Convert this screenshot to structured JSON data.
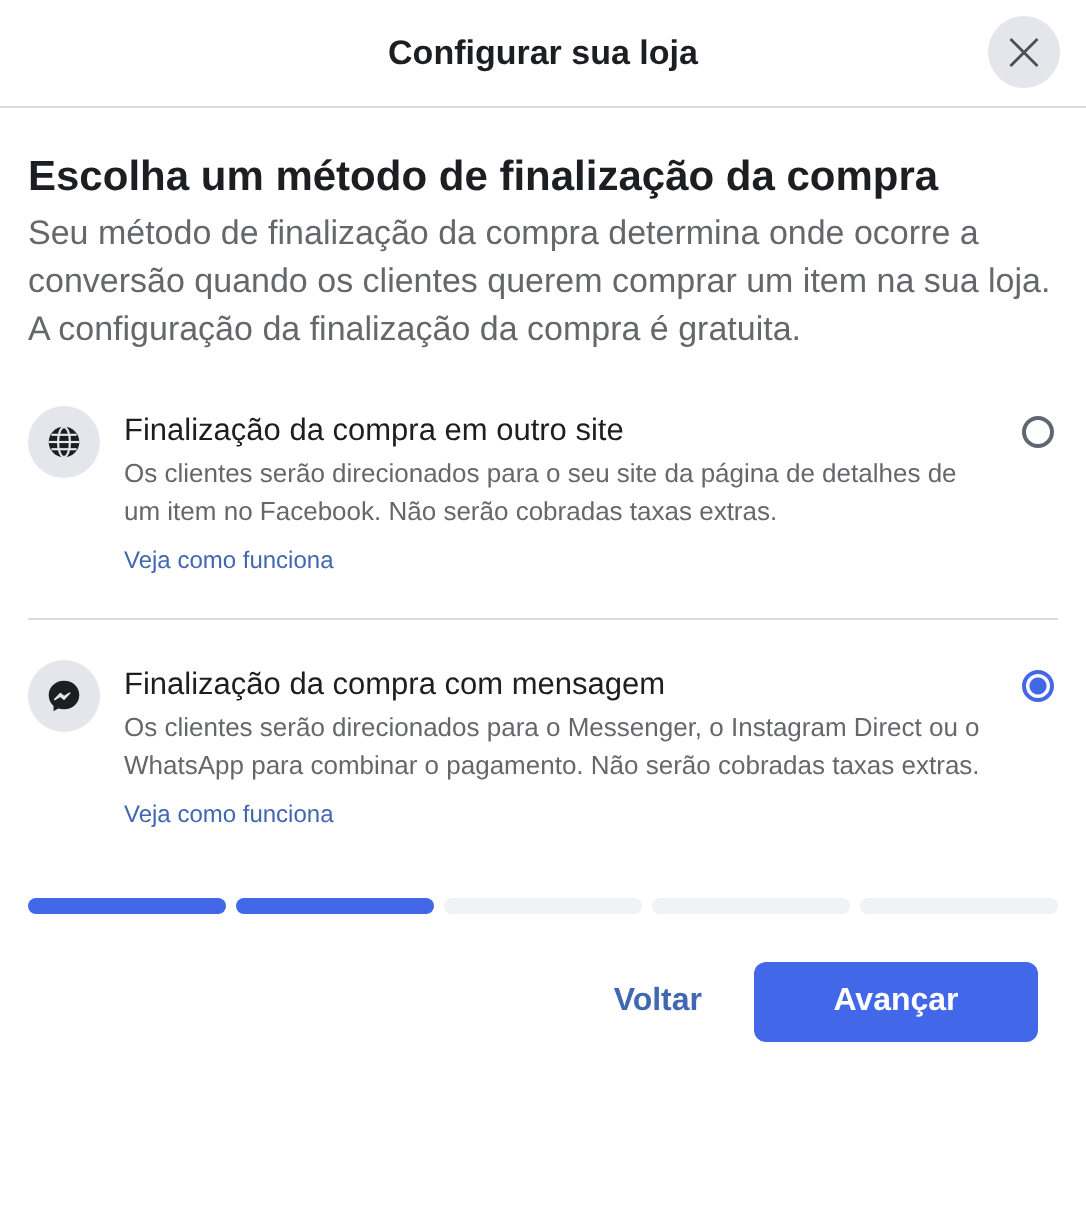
{
  "dialog": {
    "title": "Configurar sua loja",
    "close": "×"
  },
  "heading": "Escolha um método de finalização da compra",
  "description": "Seu método de finalização da compra determina onde ocorre a conversão quando os clientes querem comprar um item na sua loja. A configuração da finalização da compra é gratuita.",
  "options": [
    {
      "kind": "globe",
      "title": "Finalização da compra em outro site",
      "text": "Os clientes serão direcionados para o seu site da página de detalhes de um item no Facebook. Não serão cobradas taxas extras.",
      "link": "Veja como funciona",
      "selected": false
    },
    {
      "kind": "messenger",
      "title": "Finalização da compra com mensagem",
      "text": "Os clientes serão direcionados para o Messenger, o Instagram Direct ou o WhatsApp para combinar o pagamento. Não serão cobradas taxas extras.",
      "link": "Veja como funciona",
      "selected": true
    }
  ],
  "steps": [
    {
      "done": true
    },
    {
      "done": true
    },
    {
      "done": false
    },
    {
      "done": false
    },
    {
      "done": false
    }
  ],
  "buttons": {
    "back": "Voltar",
    "next": "Avançar"
  }
}
